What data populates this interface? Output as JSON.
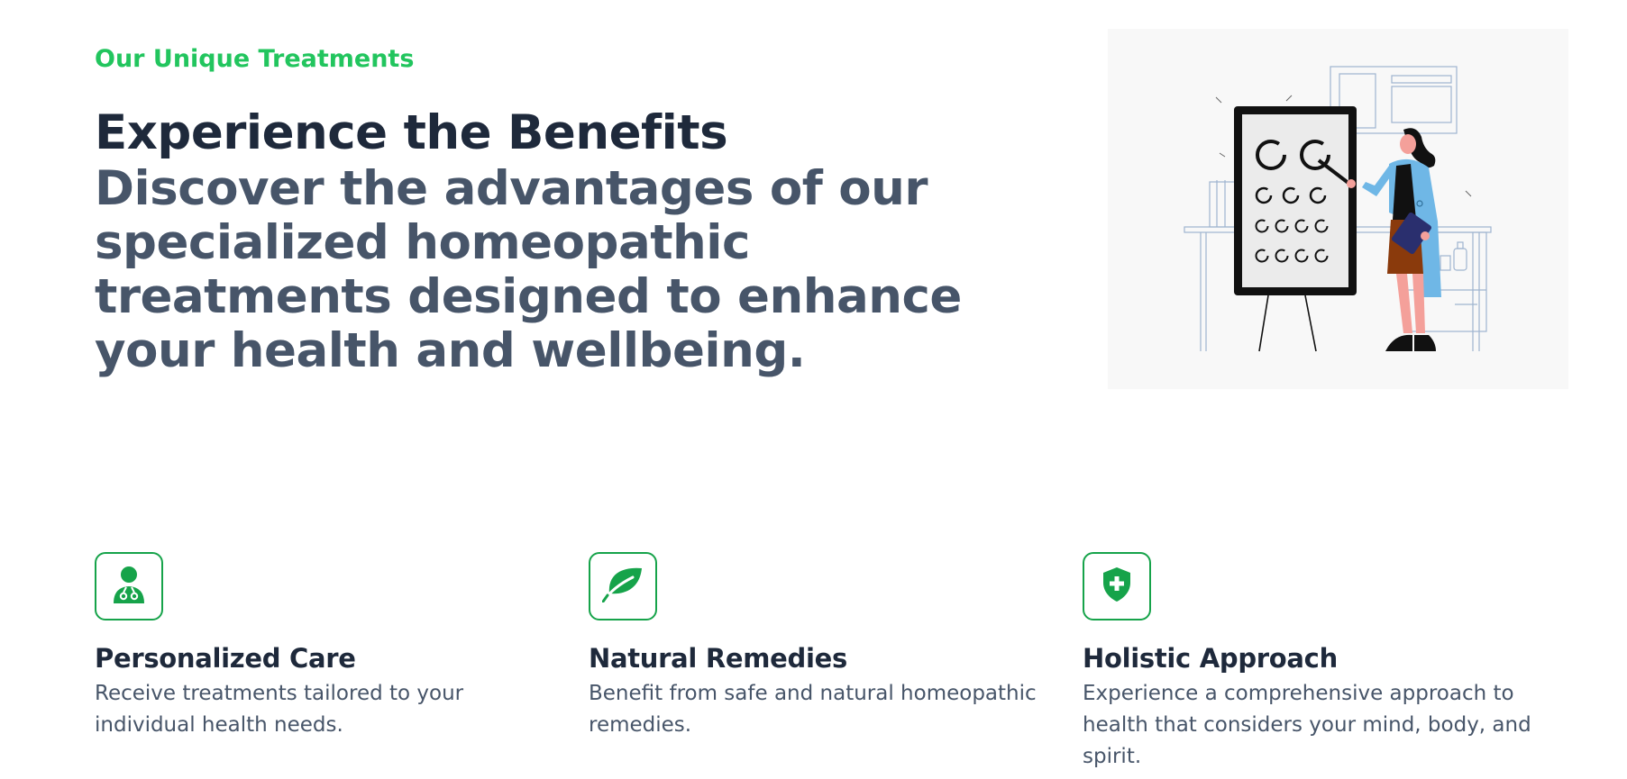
{
  "section": {
    "eyebrow": "Our Unique Treatments",
    "title": "Experience the Benefits",
    "subtitle": "Discover the advantages of our specialized homeopathic treatments designed to enhance your health and wellbeing."
  },
  "illustration": {
    "subject": "doctor-pointing-at-eye-chart",
    "background_color": "#f8f8f8"
  },
  "features": [
    {
      "icon": "doctor-icon",
      "title": "Personalized Care",
      "description": "Receive treatments tailored to your individual health needs."
    },
    {
      "icon": "leaf-icon",
      "title": "Natural Remedies",
      "description": "Benefit from safe and natural homeopathic remedies."
    },
    {
      "icon": "shield-plus-icon",
      "title": "Holistic Approach",
      "description": "Experience a comprehensive approach to health that considers your mind, body, and spirit."
    }
  ],
  "colors": {
    "accent_green": "#22c55e",
    "icon_green": "#16a34a",
    "heading": "#1e293b",
    "body_text": "#475569"
  }
}
